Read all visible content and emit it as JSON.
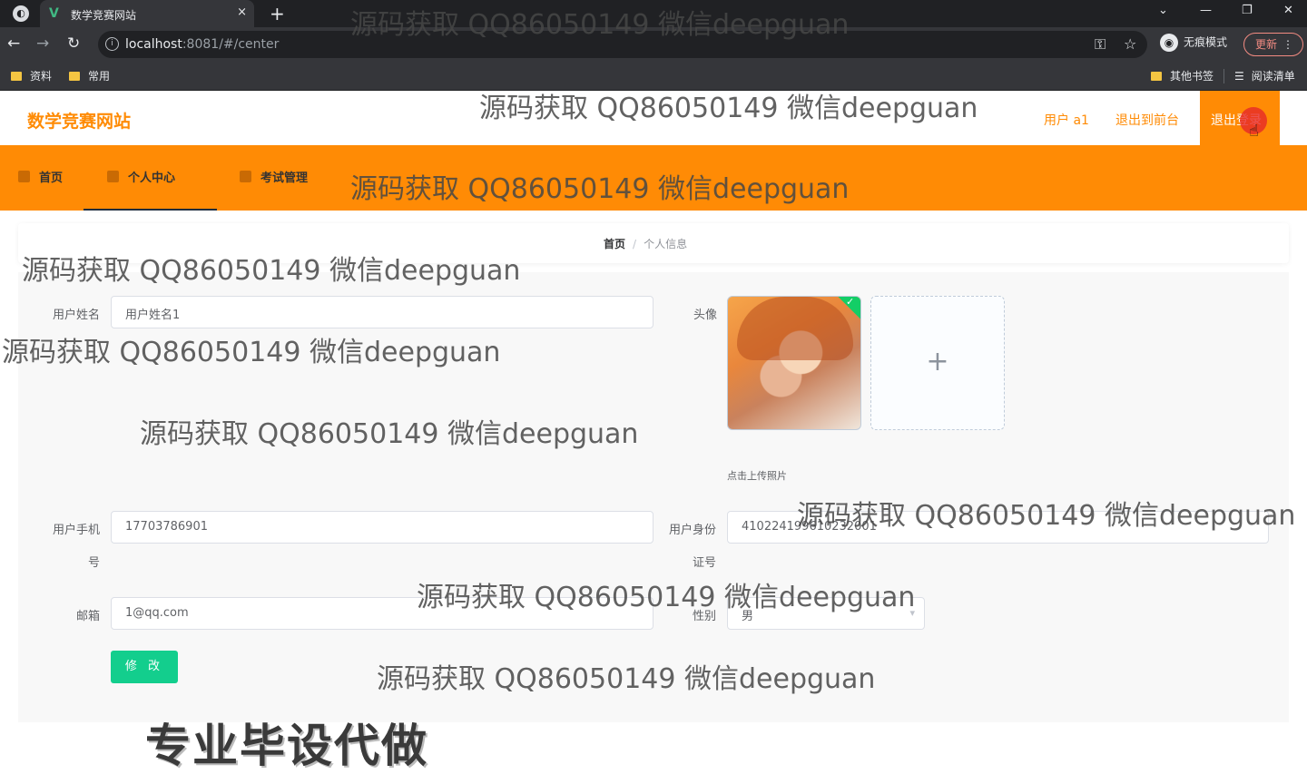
{
  "browser": {
    "tab_title": "数学竞赛网站",
    "tab_close": "×",
    "new_tab": "+",
    "url_host": "localhost",
    "url_rest": ":8081/#/center",
    "incognito_label": "无痕模式",
    "update_label": "更新",
    "update_menu": "⋮",
    "window_controls": {
      "dropdown": "⌄",
      "minimize": "—",
      "restore": "❐",
      "close": "✕"
    },
    "nav": {
      "back": "←",
      "forward": "→",
      "reload": "↻"
    },
    "bookmarks": [
      "资料",
      "常用"
    ],
    "bookmarks_right": {
      "other": "其他书签",
      "reading_list": "阅读清单"
    }
  },
  "header": {
    "logo": "数学竞赛网站",
    "user_label": "用户 a1",
    "back_to_front": "退出到前台",
    "logout": "退出登录"
  },
  "nav": {
    "items": [
      {
        "label": "首页"
      },
      {
        "label": "个人中心"
      },
      {
        "label": "考试管理"
      }
    ]
  },
  "breadcrumb": {
    "home": "首页",
    "separator": "/",
    "current": "个人信息"
  },
  "form": {
    "name_label": "用户姓名",
    "name_value": "用户姓名1",
    "avatar_label": "头像",
    "upload_plus": "+",
    "upload_tip": "点击上传照片",
    "phone_label_1": "用户手机",
    "phone_label_2": "号",
    "phone_value": "17703786901",
    "id_label_1": "用户身份",
    "id_label_2": "证号",
    "id_value": "410224199610232001",
    "email_label": "邮箱",
    "email_value": "1@qq.com",
    "gender_label": "性别",
    "gender_value": "男",
    "submit": "修 改"
  },
  "overlay": {
    "watermark": "源码获取 QQ86050149 微信deepguan",
    "promo": "专业毕设代做"
  },
  "colors": {
    "brand_orange": "#ff8b05",
    "submit_green": "#13ce8d",
    "chrome_dark": "#202124",
    "chrome_mid": "#35363a"
  }
}
